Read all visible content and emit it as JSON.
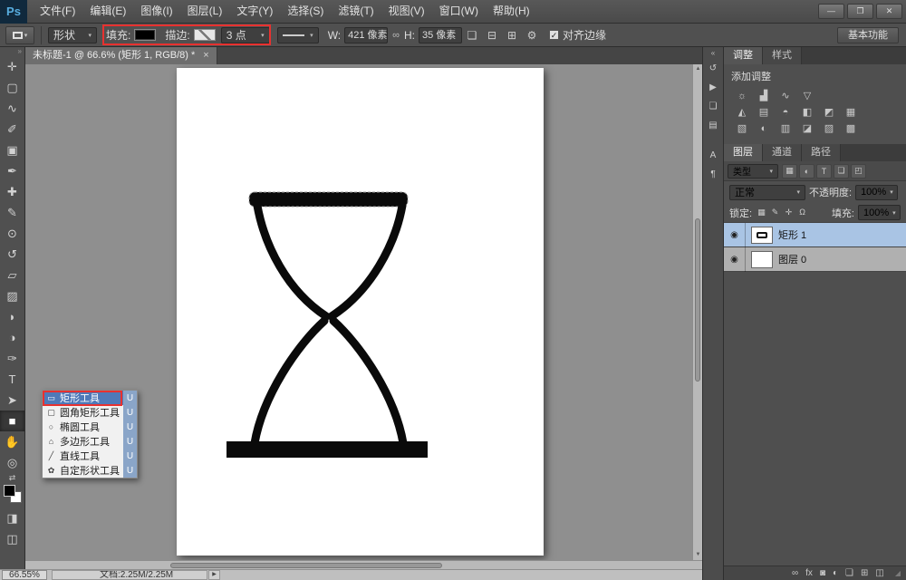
{
  "menubar": {
    "logo": "Ps",
    "menus": [
      {
        "name": "menu-file",
        "label": "文件(F)"
      },
      {
        "name": "menu-edit",
        "label": "编辑(E)"
      },
      {
        "name": "menu-image",
        "label": "图像(I)"
      },
      {
        "name": "menu-layer",
        "label": "图层(L)"
      },
      {
        "name": "menu-type",
        "label": "文字(Y)"
      },
      {
        "name": "menu-select",
        "label": "选择(S)"
      },
      {
        "name": "menu-filter",
        "label": "滤镜(T)"
      },
      {
        "name": "menu-view",
        "label": "视图(V)"
      },
      {
        "name": "menu-window",
        "label": "窗口(W)"
      },
      {
        "name": "menu-help",
        "label": "帮助(H)"
      }
    ],
    "window_controls": {
      "minimize": "—",
      "restore": "❐",
      "close": "✕"
    }
  },
  "options_bar": {
    "tool_preset_arrow": "▾",
    "mode_value": "形状",
    "mode_arrow": "▾",
    "fill_label": "填充:",
    "stroke_label": "描边:",
    "stroke_width_value": "3 点",
    "stroke_width_arrow": "▾",
    "stroke_style_arrow": "▾",
    "w_label": "W:",
    "w_value": "421 像素",
    "link_glyph": "∞",
    "h_label": "H:",
    "h_value": "35 像素",
    "path_op_icons": [
      {
        "name": "path-operations-icon",
        "glyph": "❏"
      },
      {
        "name": "path-alignment-icon",
        "glyph": "⊟"
      },
      {
        "name": "path-arrange-icon",
        "glyph": "⊞"
      }
    ],
    "gear_glyph": "⚙",
    "align_edges_checked": "✓",
    "align_edges_label": "对齐边缘",
    "workspace_label": "基本功能"
  },
  "document_tab": {
    "title": "未标题-1 @ 66.6% (矩形 1, RGB/8) *",
    "close_glyph": "×"
  },
  "toolbar": {
    "collapse_glyph": "»",
    "tools": [
      {
        "name": "move-tool",
        "glyph": "✛"
      },
      {
        "name": "marquee-tool",
        "glyph": "▢"
      },
      {
        "name": "lasso-tool",
        "glyph": "∿"
      },
      {
        "name": "quick-selection-tool",
        "glyph": "✐"
      },
      {
        "name": "crop-tool",
        "glyph": "▣"
      },
      {
        "name": "eyedropper-tool",
        "glyph": "✒"
      },
      {
        "name": "healing-brush-tool",
        "glyph": "✚"
      },
      {
        "name": "brush-tool",
        "glyph": "✎"
      },
      {
        "name": "clone-stamp-tool",
        "glyph": "⊙"
      },
      {
        "name": "history-brush-tool",
        "glyph": "↺"
      },
      {
        "name": "eraser-tool",
        "glyph": "▱"
      },
      {
        "name": "gradient-tool",
        "glyph": "▨"
      },
      {
        "name": "blur-tool",
        "glyph": "◗"
      },
      {
        "name": "dodge-tool",
        "glyph": "◑"
      },
      {
        "name": "pen-tool",
        "glyph": "✑"
      },
      {
        "name": "type-tool",
        "glyph": "T"
      },
      {
        "name": "path-selection-tool",
        "glyph": "➤"
      },
      {
        "name": "rectangle-tool",
        "glyph": "■",
        "active": true
      },
      {
        "name": "hand-tool",
        "glyph": "✋"
      },
      {
        "name": "zoom-tool",
        "glyph": "◎"
      }
    ],
    "swap_glyph": "⇄",
    "quick_mask_glyph": "◨",
    "screen_mode_glyph": "◫"
  },
  "flyout": {
    "items": [
      {
        "name": "flyout-rectangle-tool",
        "icon": "▭",
        "label": "矩形工具",
        "shortcut": "U",
        "selected": true
      },
      {
        "name": "flyout-rounded-rectangle-tool",
        "icon": "▢",
        "label": "圆角矩形工具",
        "shortcut": "U"
      },
      {
        "name": "flyout-ellipse-tool",
        "icon": "○",
        "label": "椭圆工具",
        "shortcut": "U"
      },
      {
        "name": "flyout-polygon-tool",
        "icon": "⌂",
        "label": "多边形工具",
        "shortcut": "U"
      },
      {
        "name": "flyout-line-tool",
        "icon": "╱",
        "label": "直线工具",
        "shortcut": "U"
      },
      {
        "name": "flyout-custom-shape-tool",
        "icon": "✿",
        "label": "自定形状工具",
        "shortcut": "U"
      }
    ]
  },
  "rail": {
    "collapse_glyph": "«",
    "group1": [
      {
        "name": "history-panel-icon",
        "glyph": "↺"
      },
      {
        "name": "actions-panel-icon",
        "glyph": "▶"
      },
      {
        "name": "clone-source-panel-icon",
        "glyph": "❏"
      },
      {
        "name": "info-panel-icon",
        "glyph": "▤"
      }
    ],
    "group2": [
      {
        "name": "character-panel-icon",
        "glyph": "A"
      },
      {
        "name": "paragraph-panel-icon",
        "glyph": "¶"
      }
    ]
  },
  "adjustments_panel": {
    "tabs": [
      {
        "name": "tab-adjustments",
        "label": "调整",
        "active": true
      },
      {
        "name": "tab-styles",
        "label": "样式"
      }
    ],
    "menu_glyph": "≡",
    "add_label": "添加调整",
    "row1": [
      {
        "name": "brightness-contrast-icon",
        "glyph": "☼"
      },
      {
        "name": "levels-icon",
        "glyph": "▟"
      },
      {
        "name": "curves-icon",
        "glyph": "∿"
      },
      {
        "name": "exposure-icon",
        "glyph": "▽"
      }
    ],
    "row2": [
      {
        "name": "vibrance-icon",
        "glyph": "◭"
      },
      {
        "name": "hue-saturation-icon",
        "glyph": "▤"
      },
      {
        "name": "color-balance-icon",
        "glyph": "◓"
      },
      {
        "name": "black-white-icon",
        "glyph": "◧"
      },
      {
        "name": "photo-filter-icon",
        "glyph": "◩"
      },
      {
        "name": "channel-mixer-icon",
        "glyph": "▦"
      }
    ],
    "row3": [
      {
        "name": "color-lookup-icon",
        "glyph": "▧"
      },
      {
        "name": "invert-icon",
        "glyph": "◐"
      },
      {
        "name": "posterize-icon",
        "glyph": "▥"
      },
      {
        "name": "threshold-icon",
        "glyph": "◪"
      },
      {
        "name": "gradient-map-icon",
        "glyph": "▨"
      },
      {
        "name": "selective-color-icon",
        "glyph": "▩"
      }
    ]
  },
  "layers_panel": {
    "tabs": [
      {
        "name": "tab-layers",
        "label": "图层",
        "active": true
      },
      {
        "name": "tab-channels",
        "label": "通道"
      },
      {
        "name": "tab-paths",
        "label": "路径"
      }
    ],
    "menu_glyph": "≡",
    "filter_label": "类型",
    "filter_arrow": "▾",
    "filter_icons": [
      {
        "name": "filter-pixel-layers-icon",
        "glyph": "▦"
      },
      {
        "name": "filter-adjustment-layers-icon",
        "glyph": "◐"
      },
      {
        "name": "filter-type-layers-icon",
        "glyph": "T"
      },
      {
        "name": "filter-shape-layers-icon",
        "glyph": "❏"
      },
      {
        "name": "filter-smart-objects-icon",
        "glyph": "◰"
      }
    ],
    "blend_mode_value": "正常",
    "blend_arrow": "▾",
    "opacity_label": "不透明度:",
    "opacity_value": "100%",
    "opacity_arrow": "▾",
    "lock_label": "锁定:",
    "lock_icons": [
      {
        "name": "lock-transparency-icon",
        "glyph": "▦"
      },
      {
        "name": "lock-pixels-icon",
        "glyph": "✎"
      },
      {
        "name": "lock-position-icon",
        "glyph": "✛"
      },
      {
        "name": "lock-all-icon",
        "glyph": "Ω"
      }
    ],
    "fill_label": "填充:",
    "fill_value": "100%",
    "fill_arrow": "▾",
    "eye_glyph": "◉",
    "items": [
      {
        "label": "矩形 1",
        "selected": true
      },
      {
        "label": "图层 0",
        "selected": false
      }
    ],
    "footer_icons": [
      {
        "name": "link-layers-icon",
        "glyph": "∞"
      },
      {
        "name": "layer-effects-icon",
        "glyph": "fx"
      },
      {
        "name": "layer-mask-icon",
        "glyph": "◙"
      },
      {
        "name": "adjustment-layer-icon",
        "glyph": "◐"
      },
      {
        "name": "layer-group-icon",
        "glyph": "❏"
      },
      {
        "name": "new-layer-icon",
        "glyph": "⊞"
      },
      {
        "name": "delete-layer-icon",
        "glyph": "◫"
      }
    ],
    "resize_grip": "◢"
  },
  "status_bar": {
    "zoom_value": "66.55%",
    "doc_info": "文档:2.25M/2.25M",
    "arrow_glyph": "▶"
  }
}
